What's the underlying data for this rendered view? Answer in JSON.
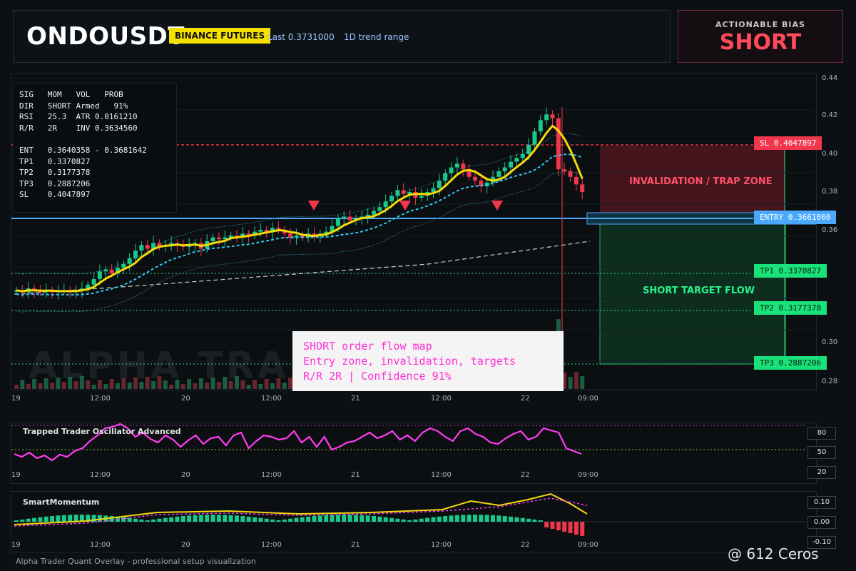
{
  "header": {
    "symbol": "ONDOUSDT",
    "exchange_badge": "BINANCE FUTURES",
    "last_price": "Last 0.3731000",
    "range": "1D trend range"
  },
  "bias": {
    "label": "ACTIONABLE BIAS",
    "value": "SHORT"
  },
  "stats_text": "SIG   MOM   VOL   PROB\nDIR   SHORT Armed   91%\nRSI   25.3  ATR 0.0161210\nR/R   2R    INV 0.3634560\n\nENT   0.3640358 - 0.3681642\nTP1   0.3370827\nTP2   0.3177378\nTP3   0.2887206\nSL    0.4047897",
  "levels": {
    "sl": "SL 0.4047897",
    "entry": "ENTRY 0.3661000",
    "tp1": "TP1 0.3370827",
    "tp2": "TP2 0.3177378",
    "tp3": "TP3 0.2887206"
  },
  "zones": {
    "trap": "INVALIDATION / TRAP ZONE",
    "target": "SHORT TARGET FLOW"
  },
  "note": {
    "line1": "SHORT order flow map",
    "line2": "Entry zone, invalidation, targets",
    "line3": "R/R 2R | Confidence 91%"
  },
  "background_watermark": "ALPHA TRADER",
  "y_axis": [
    "0.44",
    "0.42",
    "0.40",
    "0.38",
    "0.36",
    "0.30",
    "0.28"
  ],
  "x_axis": [
    "19",
    "12:00",
    "20",
    "12:00",
    "21",
    "12:00",
    "22",
    "09:00"
  ],
  "oscillator": {
    "title": "Trapped Trader Oscillator Advanced",
    "levels": [
      "80",
      "50",
      "20"
    ]
  },
  "momentum": {
    "title": "SmartMomentum",
    "levels": [
      "0.10",
      "0.00",
      "-0.10"
    ]
  },
  "footer": "Alpha Trader Quant Overlay - professional setup visualization",
  "watermark": "@ 612 Ceros",
  "colors": {
    "bull": "#19c98a",
    "bear": "#f0374c",
    "ema": "#f5d90a",
    "accent": "#4aa8ff",
    "magenta": "#ff3df0"
  }
}
